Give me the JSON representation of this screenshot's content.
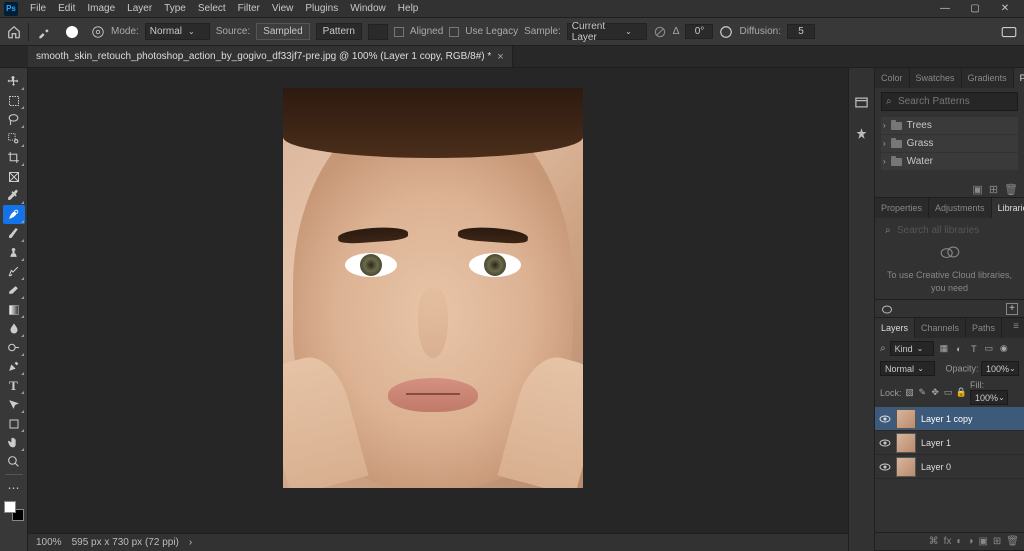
{
  "menu": {
    "items": [
      "File",
      "Edit",
      "Image",
      "Layer",
      "Type",
      "Select",
      "Filter",
      "View",
      "Plugins",
      "Window",
      "Help"
    ]
  },
  "options": {
    "mode_label": "Mode:",
    "mode_value": "Normal",
    "source_label": "Source:",
    "source_sampled": "Sampled",
    "source_pattern": "Pattern",
    "aligned": "Aligned",
    "legacy": "Use Legacy",
    "sample_label": "Sample:",
    "sample_value": "Current Layer",
    "angle_label": "Δ",
    "angle_value": "0°",
    "diffusion_label": "Diffusion:",
    "diffusion_value": "5"
  },
  "tab": {
    "title": "smooth_skin_retouch_photoshop_action_by_gogivo_df33jf7-pre.jpg @ 100% (Layer 1 copy, RGB/8#) *"
  },
  "status": {
    "zoom": "100%",
    "dims": "595 px x 730 px (72 ppi)"
  },
  "patterns": {
    "tabs": [
      "Color",
      "Swatches",
      "Gradients",
      "Patterns"
    ],
    "search_placeholder": "Search Patterns",
    "folders": [
      "Trees",
      "Grass",
      "Water"
    ]
  },
  "libraries": {
    "tabs": [
      "Properties",
      "Adjustments",
      "Libraries"
    ],
    "search_placeholder": "Search all libraries",
    "msg": "To use Creative Cloud libraries, you need"
  },
  "layers": {
    "tabs": [
      "Layers",
      "Channels",
      "Paths"
    ],
    "kind_label": "Kind",
    "blend_value": "Normal",
    "opacity_label": "Opacity:",
    "opacity_value": "100%",
    "lock_label": "Lock:",
    "fill_label": "Fill:",
    "fill_value": "100%",
    "items": [
      {
        "name": "Layer 1 copy",
        "selected": true
      },
      {
        "name": "Layer 1",
        "selected": false
      },
      {
        "name": "Layer 0",
        "selected": false
      }
    ]
  }
}
